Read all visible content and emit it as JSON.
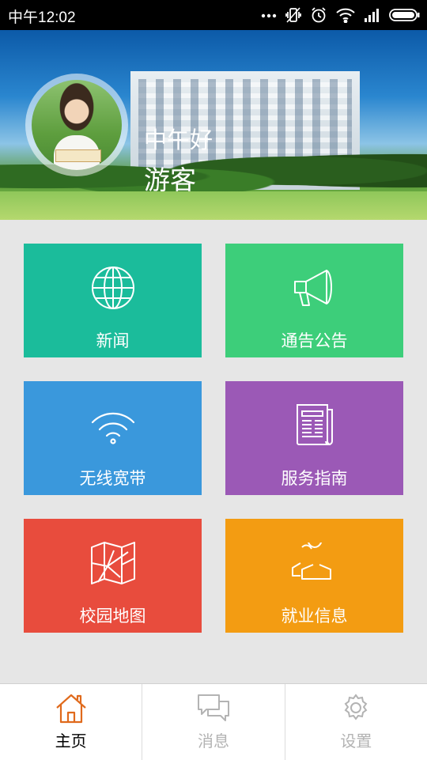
{
  "status_bar": {
    "time": "中午12:02",
    "icons": [
      "more-icon",
      "vibrate-icon",
      "alarm-icon",
      "wifi-icon",
      "signal-icon",
      "battery-icon"
    ]
  },
  "header": {
    "greeting": "中午好",
    "username": "游客"
  },
  "tiles": [
    {
      "label": "新闻",
      "icon": "globe-icon",
      "color": "#1abc9c"
    },
    {
      "label": "通告公告",
      "icon": "megaphone-icon",
      "color": "#3ecf7a"
    },
    {
      "label": "无线宽带",
      "icon": "wifi-icon",
      "color": "#3498db"
    },
    {
      "label": "服务指南",
      "icon": "newspaper-icon",
      "color": "#9b59b6"
    },
    {
      "label": "校园地图",
      "icon": "map-icon",
      "color": "#e74c3c"
    },
    {
      "label": "就业信息",
      "icon": "users-icon",
      "color": "#f39c12"
    }
  ],
  "bottom_nav": [
    {
      "label": "主页",
      "icon": "home-icon",
      "active": true,
      "color": "#e06a1c"
    },
    {
      "label": "消息",
      "icon": "chat-icon",
      "active": false,
      "color": "#b3b3b3"
    },
    {
      "label": "设置",
      "icon": "gear-icon",
      "active": false,
      "color": "#b3b3b3"
    }
  ]
}
